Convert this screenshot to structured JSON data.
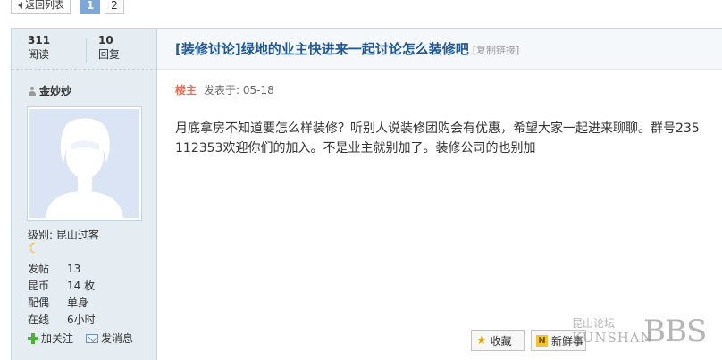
{
  "pager": {
    "back_label": "返回列表",
    "pages": [
      "1",
      "2"
    ],
    "current_page": "1"
  },
  "stats": {
    "views_count": "311",
    "views_label": "阅读",
    "replies_count": "10",
    "replies_label": "回复"
  },
  "thread": {
    "title": "[装修讨论]绿地的业主快进来一起讨论怎么装修吧",
    "copy_link": "[复制链接]"
  },
  "author": {
    "name": "金妙妙",
    "level": "级别: 昆山过客",
    "level_icon": "moon-icon",
    "info": [
      {
        "key": "发帖",
        "value": "13"
      },
      {
        "key": "昆币",
        "value": "14 枚"
      },
      {
        "key": "配偶",
        "value": "单身"
      },
      {
        "key": "在线",
        "value": "6小时"
      }
    ],
    "follow_label": "加关注",
    "message_label": "发消息"
  },
  "post": {
    "floor_label": "楼主",
    "posted_at": "发表于: 05-18",
    "body": "月底拿房不知道要怎么样装修？听别人说装修团购会有优惠，希望大家一起进来聊聊。群号235112353欢迎你们的加入。不是业主就别加了。装修公司的也别加"
  },
  "buttons": {
    "favorite_label": "收藏",
    "new_label": "新鲜事"
  },
  "watermark": {
    "line1": "昆山论坛",
    "line2": "KUNSHAN",
    "big": "BBS"
  },
  "colors": {
    "accent": "#1f5894",
    "sidebar_bg": "#e5edf2",
    "floor_label": "#f26c4f",
    "current_page": "#7da7d9"
  }
}
